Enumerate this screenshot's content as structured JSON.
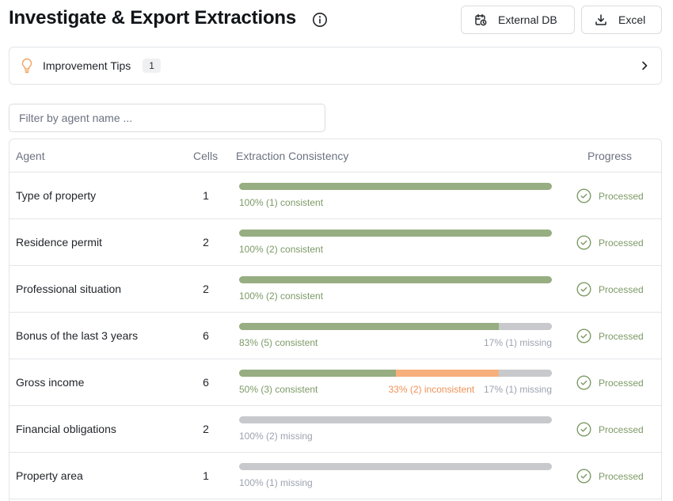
{
  "header": {
    "title": "Investigate & Export Extractions",
    "info_icon": "info-icon",
    "buttons": {
      "external_db": "External DB",
      "excel": "Excel"
    }
  },
  "tips": {
    "label": "Improvement Tips",
    "count": "1"
  },
  "filter": {
    "placeholder": "Filter by agent name ...",
    "value": ""
  },
  "table": {
    "columns": {
      "agent": "Agent",
      "cells": "Cells",
      "consistency": "Extraction Consistency",
      "progress": "Progress"
    },
    "rows": [
      {
        "agent": "Type of property",
        "cells": "1",
        "consistent_pct": 100,
        "inconsistent_pct": 0,
        "missing_pct": 0,
        "consistent_label": "100% (1) consistent",
        "inconsistent_label": "",
        "missing_label": "",
        "status": "Processed"
      },
      {
        "agent": "Residence permit",
        "cells": "2",
        "consistent_pct": 100,
        "inconsistent_pct": 0,
        "missing_pct": 0,
        "consistent_label": "100% (2) consistent",
        "inconsistent_label": "",
        "missing_label": "",
        "status": "Processed"
      },
      {
        "agent": "Professional situation",
        "cells": "2",
        "consistent_pct": 100,
        "inconsistent_pct": 0,
        "missing_pct": 0,
        "consistent_label": "100% (2) consistent",
        "inconsistent_label": "",
        "missing_label": "",
        "status": "Processed"
      },
      {
        "agent": "Bonus of the last 3 years",
        "cells": "6",
        "consistent_pct": 83,
        "inconsistent_pct": 0,
        "missing_pct": 17,
        "consistent_label": "83% (5) consistent",
        "inconsistent_label": "",
        "missing_label": "17% (1) missing",
        "status": "Processed"
      },
      {
        "agent": "Gross income",
        "cells": "6",
        "consistent_pct": 50,
        "inconsistent_pct": 33,
        "missing_pct": 17,
        "consistent_label": "50% (3) consistent",
        "inconsistent_label": "33% (2) inconsistent",
        "missing_label": "17% (1) missing",
        "status": "Processed"
      },
      {
        "agent": "Financial obligations",
        "cells": "2",
        "consistent_pct": 0,
        "inconsistent_pct": 0,
        "missing_pct": 100,
        "consistent_label": "",
        "inconsistent_label": "",
        "missing_label": "100% (2) missing",
        "status": "Processed"
      },
      {
        "agent": "Property area",
        "cells": "1",
        "consistent_pct": 0,
        "inconsistent_pct": 0,
        "missing_pct": 100,
        "consistent_label": "",
        "inconsistent_label": "",
        "missing_label": "100% (1) missing",
        "status": "Processed"
      }
    ]
  },
  "colors": {
    "consistent": "#97ad82",
    "inconsistent": "#f7b07b",
    "missing": "#c8c9cd",
    "processed": "#7d9a67",
    "tip_bulb": "#f0a15e"
  }
}
